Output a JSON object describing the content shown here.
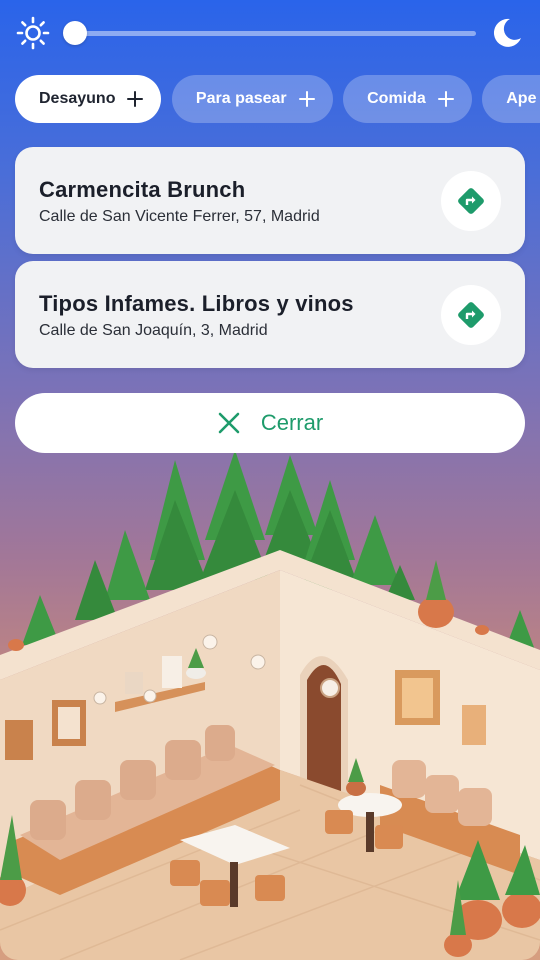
{
  "theme_slider": {
    "left_icon": "sun-icon",
    "right_icon": "moon-icon",
    "value": 0.0
  },
  "categories": [
    {
      "label": "Desayuno",
      "active": true,
      "icon": "plus-icon"
    },
    {
      "label": "Para pasear",
      "active": false,
      "icon": "plus-icon"
    },
    {
      "label": "Comida",
      "active": false,
      "icon": "plus-icon"
    },
    {
      "label": "Ape",
      "active": false,
      "icon": "plus-icon"
    }
  ],
  "places": [
    {
      "name": "Carmencita Brunch",
      "address": "Calle de San Vicente Ferrer, 57, Madrid",
      "action_icon": "directions-icon"
    },
    {
      "name": "Tipos Infames. Libros y vinos",
      "address": "Calle de San Joaquín, 3, Madrid",
      "action_icon": "directions-icon"
    }
  ],
  "close_button": {
    "label": "Cerrar",
    "icon": "close-icon"
  },
  "colors": {
    "accent": "#1e9b6b",
    "gradient_top": "#2a64ea",
    "gradient_bottom": "#d69e80"
  },
  "illustration": {
    "icon": "isometric-cafe-illustration"
  }
}
